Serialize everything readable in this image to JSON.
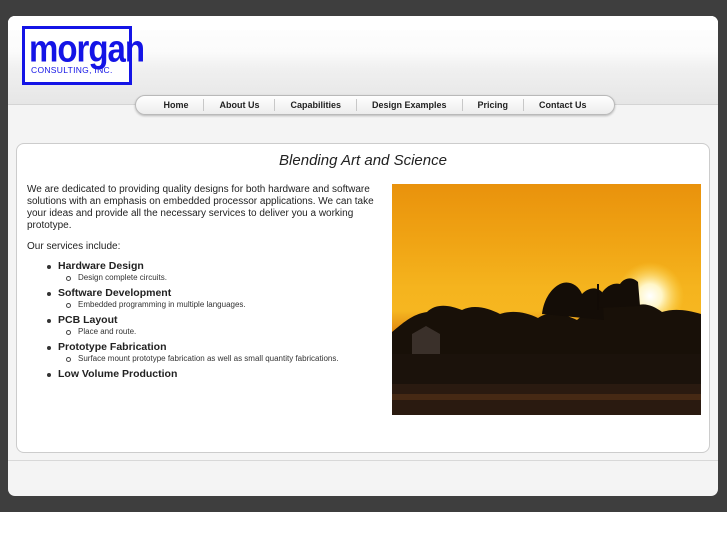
{
  "logo": {
    "word": "morgan",
    "subtitle": "CONSULTING, INC."
  },
  "nav": {
    "items": [
      "Home",
      "About Us",
      "Capabilities",
      "Design Examples",
      "Pricing",
      "Contact Us"
    ]
  },
  "main": {
    "title": "Blending Art and Science",
    "intro": "We are dedicated to providing quality designs for both hardware and software solutions with an emphasis on embedded processor applications. We can take your ideas and provide all the necessary services to deliver you a working prototype.",
    "services_intro": "Our services include:",
    "services": [
      {
        "title": "Hardware Design",
        "desc": "Design complete circuits."
      },
      {
        "title": "Software Development",
        "desc": "Embedded programming in multiple languages."
      },
      {
        "title": "PCB Layout",
        "desc": "Place and route."
      },
      {
        "title": "Prototype Fabrication",
        "desc": "Surface mount prototype fabrication as well as small quantity fabrications."
      },
      {
        "title": "Low Volume Production",
        "desc": ""
      }
    ]
  },
  "colors": {
    "logo_blue": "#1414e6",
    "frame_dark": "#3e3e3e",
    "frame_light": "#f4f4f4"
  }
}
